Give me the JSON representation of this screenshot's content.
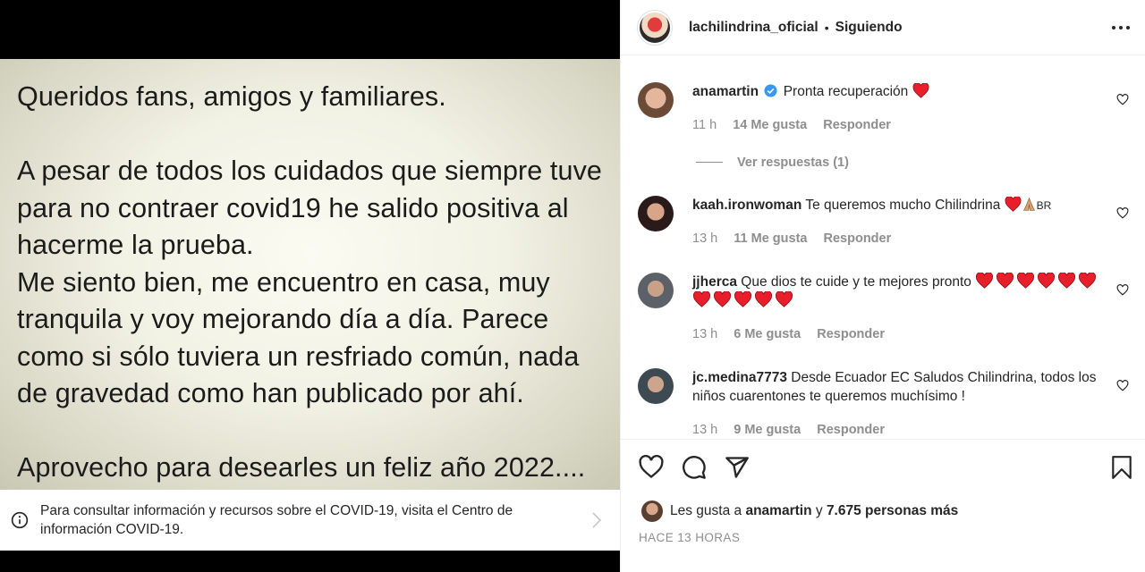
{
  "post": {
    "text": "Queridos fans, amigos y familiares.\n\nA pesar de todos los cuidados que siempre tuve para no contraer covid19  he salido positiva al hacerme la prueba.\nMe siento bien, me encuentro en casa, muy tranquila y voy mejorando día a día. Parece como si sólo tuviera un resfriado común, nada de gravedad como han publicado por ahí.\n\nAprovecho para desearles un feliz año 2022...."
  },
  "covid_banner": {
    "text": "Para consultar información y recursos sobre el COVID-19, visita el Centro de información COVID-19.",
    "icon": "info-icon"
  },
  "header": {
    "username": "lachilindrina_oficial",
    "separator": "•",
    "follow_status": "Siguiendo"
  },
  "comments": [
    {
      "user": "anamartin",
      "verified": true,
      "text": "Pronta recuperación",
      "emoji": "❤️",
      "time": "11 h",
      "likes": "14 Me gusta",
      "reply": "Responder",
      "view_replies": "Ver respuestas (1)"
    },
    {
      "user": "kaah.ironwoman",
      "text": "Te queremos mucho Chilindrina",
      "emoji": "❤️🙏🏼BR",
      "time": "13 h",
      "likes": "11 Me gusta",
      "reply": "Responder"
    },
    {
      "user": "jjherca",
      "text": "Que dios te cuide y te mejores pronto",
      "emoji": "❤️❤️❤️❤️❤️❤️❤️❤️❤️❤️❤️",
      "time": "13 h",
      "likes": "6 Me gusta",
      "reply": "Responder"
    },
    {
      "user": "jc.medina7773",
      "text": "Desde Ecuador EC Saludos Chilindrina, todos los niños cuarentones te queremos muchísimo !",
      "time": "13 h",
      "likes": "9 Me gusta",
      "reply": "Responder"
    }
  ],
  "likes": {
    "prefix": "Les gusta a",
    "user": "anamartin",
    "conj": "y",
    "others": "7.675 personas más"
  },
  "time_ago": "HACE 13 HORAS",
  "colors": {
    "heart_red": "#e81f2a",
    "secondary_text": "#8e8e8e",
    "verified_blue": "#3897f0"
  }
}
